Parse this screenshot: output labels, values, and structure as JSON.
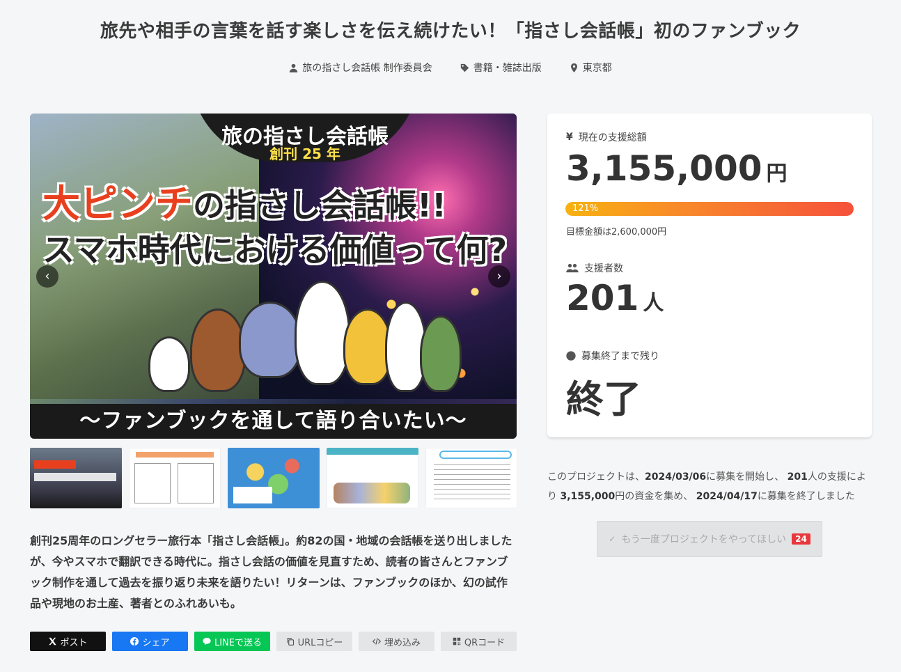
{
  "title": "旅先や相手の言葉を話す楽しさを伝え続けたい！「指さし会話帳」初のファンブック",
  "meta": {
    "owner": "旅の指さし会話帳 制作委員会",
    "category": "書籍・雑誌出版",
    "location": "東京都"
  },
  "hero": {
    "badge_title": "旅の指さし会話帳",
    "badge_sub": "創刊 25 年",
    "headline1_red": "大ピンチ",
    "headline1_black": "の指さし会話帳!!",
    "headline2": "スマホ時代における価値って何?",
    "banner": "～ファンブックを通して語り合いたい～",
    "prev_icon": "chevron-left-icon",
    "next_icon": "chevron-right-icon"
  },
  "thumbnails": [
    {
      "name": "thumbnail-1",
      "colors": [
        "#2a2a3a",
        "#e8401e"
      ]
    },
    {
      "name": "thumbnail-2",
      "colors": [
        "#ffffff",
        "#f2a36c"
      ]
    },
    {
      "name": "thumbnail-3",
      "colors": [
        "#3d8fd6",
        "#f5d35c"
      ]
    },
    {
      "name": "thumbnail-4",
      "colors": [
        "#ffffff",
        "#4ab4c6"
      ]
    },
    {
      "name": "thumbnail-5",
      "colors": [
        "#ffffff",
        "#5bb8e8"
      ]
    }
  ],
  "description": "創刊25周年のロングセラー旅行本「指さし会話帳」。約82の国・地域の会話帳を送り出しましたが、今やスマホで翻訳できる時代に。指さし会話の価値を見直すため、読者の皆さんとファンブック制作を通して過去を振り返り未来を語りたい！リターンは、ファンブックのほか、幻の試作品や現地のお土産、著者とのふれあいも。",
  "share": {
    "x": "ポスト",
    "facebook": "シェア",
    "line": "LINEで送る",
    "url_copy": "URLコピー",
    "embed": "埋め込み",
    "qr": "QRコード"
  },
  "stats": {
    "total_label": "現在の支援総額",
    "total_value": "3,155,000",
    "total_unit": "円",
    "progress_percent": 121,
    "progress_label": "121%",
    "goal": "目標金額は2,600,000円",
    "supporters_label": "支援者数",
    "supporters_value": "201",
    "supporters_unit": "人",
    "remaining_label": "募集終了まで残り",
    "remaining_value": "終了"
  },
  "summary": {
    "prefix": "このプロジェクトは、",
    "start_date": "2024/03/06",
    "mid1": "に募集を開始し、",
    "supporters": "201",
    "mid2": "人の支援により",
    "amount": "3,155,000",
    "mid3": "円の資金を集め、",
    "end_date": "2024/04/17",
    "suffix": "に募集を終了しました"
  },
  "again_button": {
    "label": "もう一度プロジェクトをやってほしい",
    "count": "24"
  },
  "colors": {
    "accent_orange": "#f8892a",
    "accent_red": "#e8383d",
    "line_green": "#06c755",
    "facebook_blue": "#1877f2"
  }
}
